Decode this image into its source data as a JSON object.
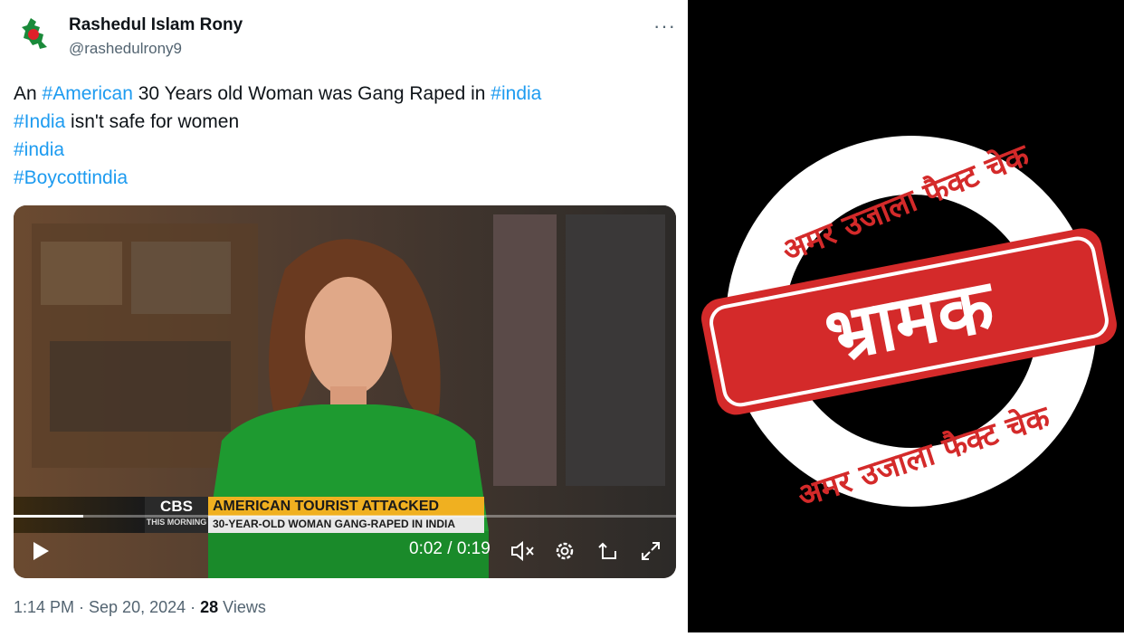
{
  "tweet": {
    "author_name": "Rashedul Islam Rony",
    "author_handle": "@rashedulrony9",
    "more_label": "···",
    "line1_pre": "An ",
    "line1_tag1": "#American",
    "line1_mid": " 30 Years old Woman was Gang Raped in ",
    "line1_tag2": "#india",
    "line2_tag": "#India",
    "line2_rest": " isn't safe for women",
    "line3_tag": "#india",
    "line4_tag": "#Boycottindia",
    "timestamp": "1:14 PM · Sep 20, 2024 · ",
    "views_count": "28",
    "views_label": " Views"
  },
  "video": {
    "lower_third_brand": "CBS",
    "lower_third_show": "THIS MORNING",
    "headline": "AMERICAN TOURIST ATTACKED",
    "subheadline": "30-YEAR-OLD WOMAN GANG-RAPED IN INDIA",
    "time_display": "0:02 / 0:19",
    "progress_fraction": 0.105,
    "icons": [
      "play-icon",
      "mute-icon",
      "settings-icon",
      "share-icon",
      "fullscreen-icon"
    ]
  },
  "stamp": {
    "top_arc": "अमर उजाला फैक्ट चेक",
    "bottom_arc": "अमर उजाला फैक्ट चेक",
    "verdict": "भ्रामक",
    "color": "#d42a2a"
  }
}
